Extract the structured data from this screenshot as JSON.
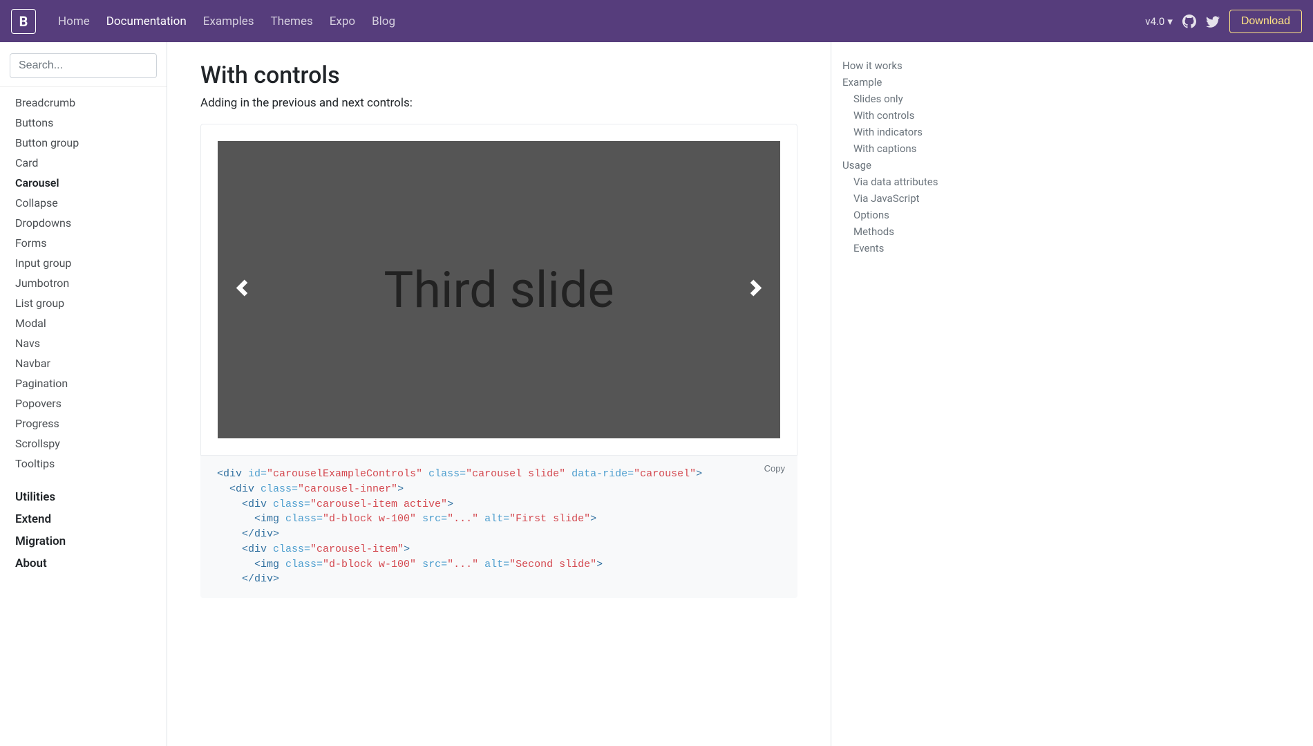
{
  "navbar": {
    "brand": "B",
    "links": [
      "Home",
      "Documentation",
      "Examples",
      "Themes",
      "Expo",
      "Blog"
    ],
    "active_index": 1,
    "version": "v4.0",
    "download": "Download"
  },
  "sidebar": {
    "search_placeholder": "Search...",
    "items": [
      "Breadcrumb",
      "Buttons",
      "Button group",
      "Card",
      "Carousel",
      "Collapse",
      "Dropdowns",
      "Forms",
      "Input group",
      "Jumbotron",
      "List group",
      "Modal",
      "Navs",
      "Navbar",
      "Pagination",
      "Popovers",
      "Progress",
      "Scrollspy",
      "Tooltips"
    ],
    "active_index": 4,
    "headings": [
      "Utilities",
      "Extend",
      "Migration",
      "About"
    ]
  },
  "page": {
    "title": "With controls",
    "subtitle": "Adding in the previous and next controls:",
    "carousel_label": "Third slide",
    "copy_label": "Copy"
  },
  "code": {
    "l1_open": "<div",
    "l1_id_attr": " id=",
    "l1_id_val": "\"carouselExampleControls\"",
    "l1_class_attr": " class=",
    "l1_class_val": "\"carousel slide\"",
    "l1_ride_attr": " data-ride=",
    "l1_ride_val": "\"carousel\"",
    "close_gt": ">",
    "l2_open": "  <div",
    "l2_class_attr": " class=",
    "l2_class_val": "\"carousel-inner\"",
    "l3_open": "    <div",
    "l3_class_attr": " class=",
    "l3_class_val": "\"carousel-item active\"",
    "l4_open": "      <img",
    "l4_class_attr": " class=",
    "l4_class_val": "\"d-block w-100\"",
    "l4_src_attr": " src=",
    "l4_src_val": "\"...\"",
    "l4_alt_attr": " alt=",
    "l4_alt_val": "\"First slide\"",
    "l5_close": "    </div>",
    "l6_open": "    <div",
    "l6_class_attr": " class=",
    "l6_class_val": "\"carousel-item\"",
    "l7_open": "      <img",
    "l7_alt_val": "\"Second slide\"",
    "l8_close": "    </div>"
  },
  "toc": {
    "items": [
      {
        "label": "How it works",
        "sub": false
      },
      {
        "label": "Example",
        "sub": false
      },
      {
        "label": "Slides only",
        "sub": true
      },
      {
        "label": "With controls",
        "sub": true
      },
      {
        "label": "With indicators",
        "sub": true
      },
      {
        "label": "With captions",
        "sub": true
      },
      {
        "label": "Usage",
        "sub": false
      },
      {
        "label": "Via data attributes",
        "sub": true
      },
      {
        "label": "Via JavaScript",
        "sub": true
      },
      {
        "label": "Options",
        "sub": true
      },
      {
        "label": "Methods",
        "sub": true
      },
      {
        "label": "Events",
        "sub": true
      }
    ]
  }
}
